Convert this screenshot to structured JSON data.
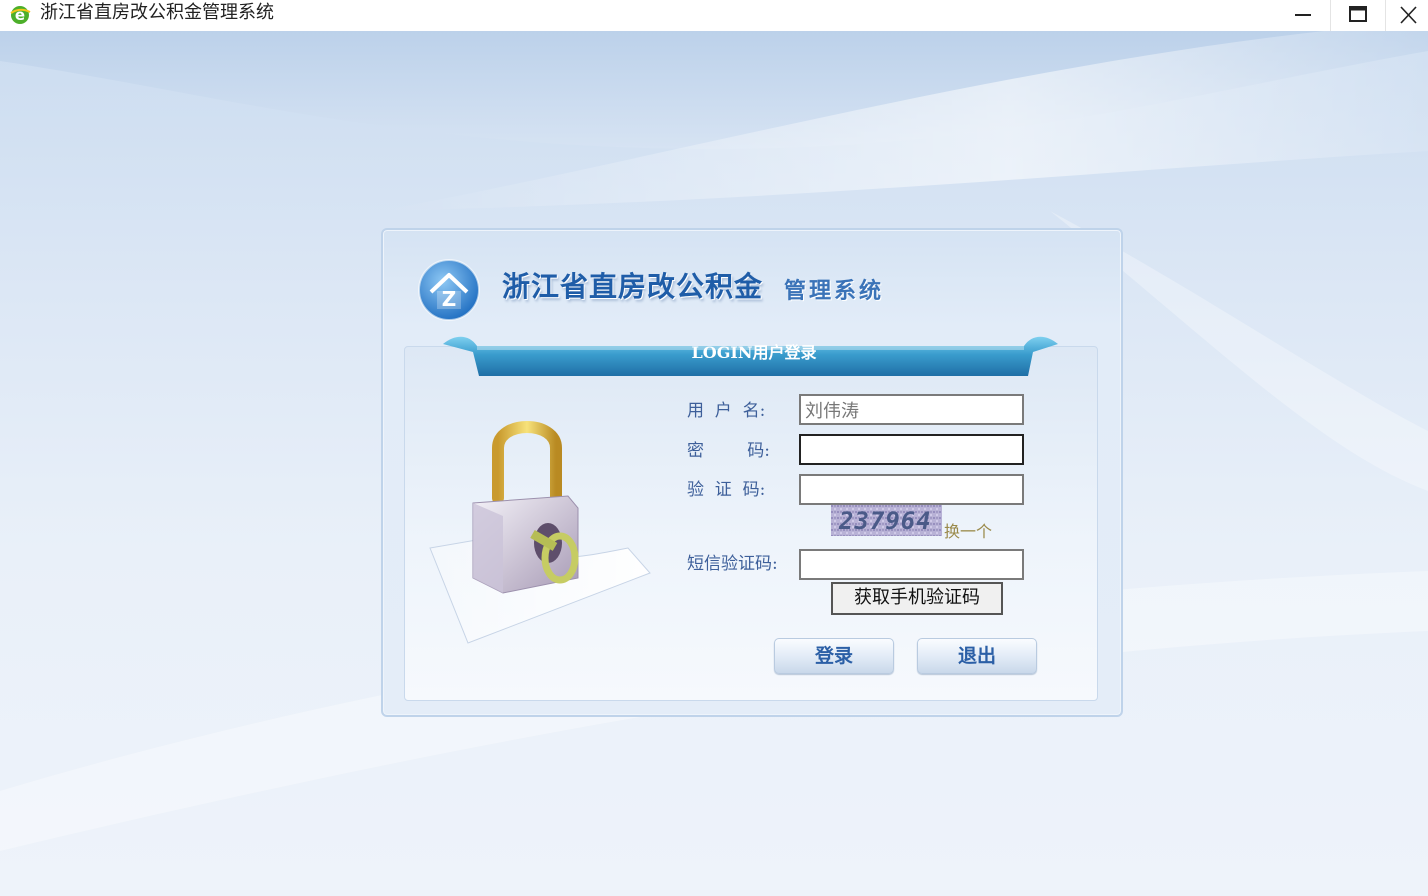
{
  "window": {
    "title": "浙江省直房改公积金管理系统"
  },
  "brand": {
    "title": "浙江省直房改公积金",
    "subtitle": "管理系统",
    "logo_letter": "Z"
  },
  "login": {
    "heading": "LOGIN用户登录",
    "username_label": "用  户  名:",
    "username_value": "刘伟涛",
    "password_label": "密        码:",
    "captcha_label": "验  证  码:",
    "captcha_text": "237964",
    "captcha_refresh": "换一个",
    "sms_label": "短信验证码:",
    "sms_button": "获取手机验证码",
    "login_button": "登录",
    "exit_button": "退出"
  },
  "colors": {
    "accent": "#1f5da8",
    "ribbon": "#3a8fc2",
    "label": "#3d5f9a"
  }
}
